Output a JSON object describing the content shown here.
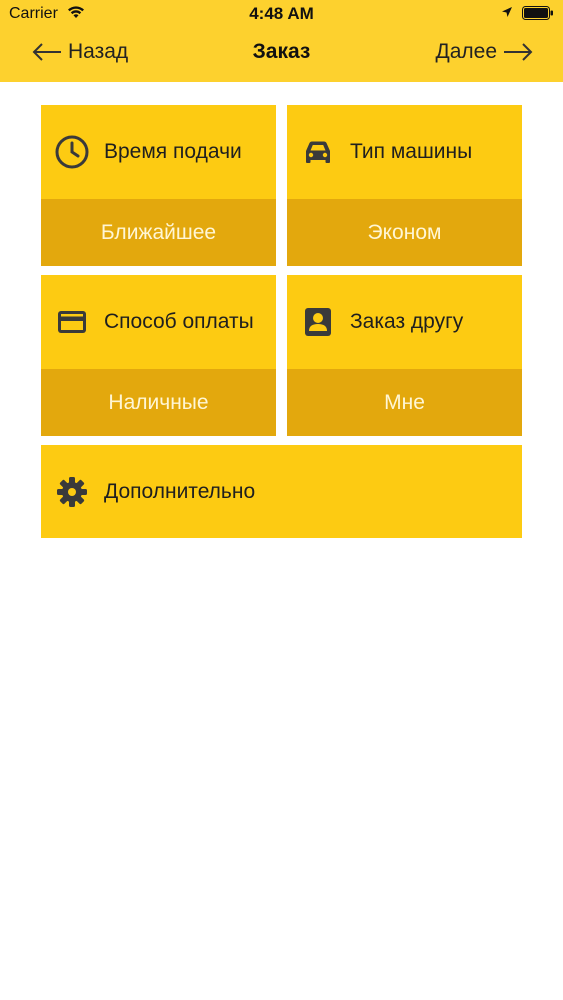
{
  "status_bar": {
    "carrier": "Carrier",
    "time": "4:48 AM"
  },
  "nav": {
    "back_label": "Назад",
    "title": "Заказ",
    "next_label": "Далее"
  },
  "options": [
    {
      "title": "Время подачи",
      "value": "Ближайшее",
      "icon": "clock-icon"
    },
    {
      "title": "Тип машины",
      "value": "Эконом",
      "icon": "car-icon"
    },
    {
      "title": "Способ оплаты",
      "value": "Наличные",
      "icon": "credit-card-icon"
    },
    {
      "title": "Заказ другу",
      "value": "Мне",
      "icon": "contact-icon"
    }
  ],
  "extra": {
    "title": "Дополнительно",
    "icon": "gear-icon"
  },
  "colors": {
    "header": "#FDD12E",
    "card": "#FDCB12",
    "card_value_bg": "#E3A80D",
    "card_value_text": "#FFF6D5",
    "icon": "#3a3a3a"
  }
}
